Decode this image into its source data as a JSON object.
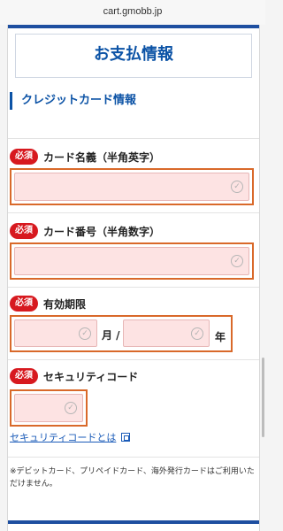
{
  "browser": {
    "url": "cart.gmobb.jp"
  },
  "header": {
    "title": "お支払情報"
  },
  "section": {
    "title": "クレジットカード情報"
  },
  "required_badge": "必須",
  "fields": {
    "card_name": {
      "label": "カード名義（半角英字）",
      "value": ""
    },
    "card_number": {
      "label": "カード番号（半角数字）",
      "value": ""
    },
    "expiry": {
      "label": "有効期限",
      "month_suffix": "月 /",
      "year_suffix": "年",
      "month_value": "",
      "year_value": ""
    },
    "security_code": {
      "label": "セキュリティコード",
      "value": ""
    }
  },
  "links": {
    "security_code_help": "セキュリティコードとは"
  },
  "note": "※デビットカード、プリペイドカード、海外発行カードはご利用いただけません。",
  "icons": {
    "check": "check-circle-icon",
    "external": "external-link-icon"
  },
  "colors": {
    "accent": "#0c53a6",
    "required": "#d7191f",
    "highlight": "#d9692a",
    "input_bg": "#fde3e3"
  }
}
